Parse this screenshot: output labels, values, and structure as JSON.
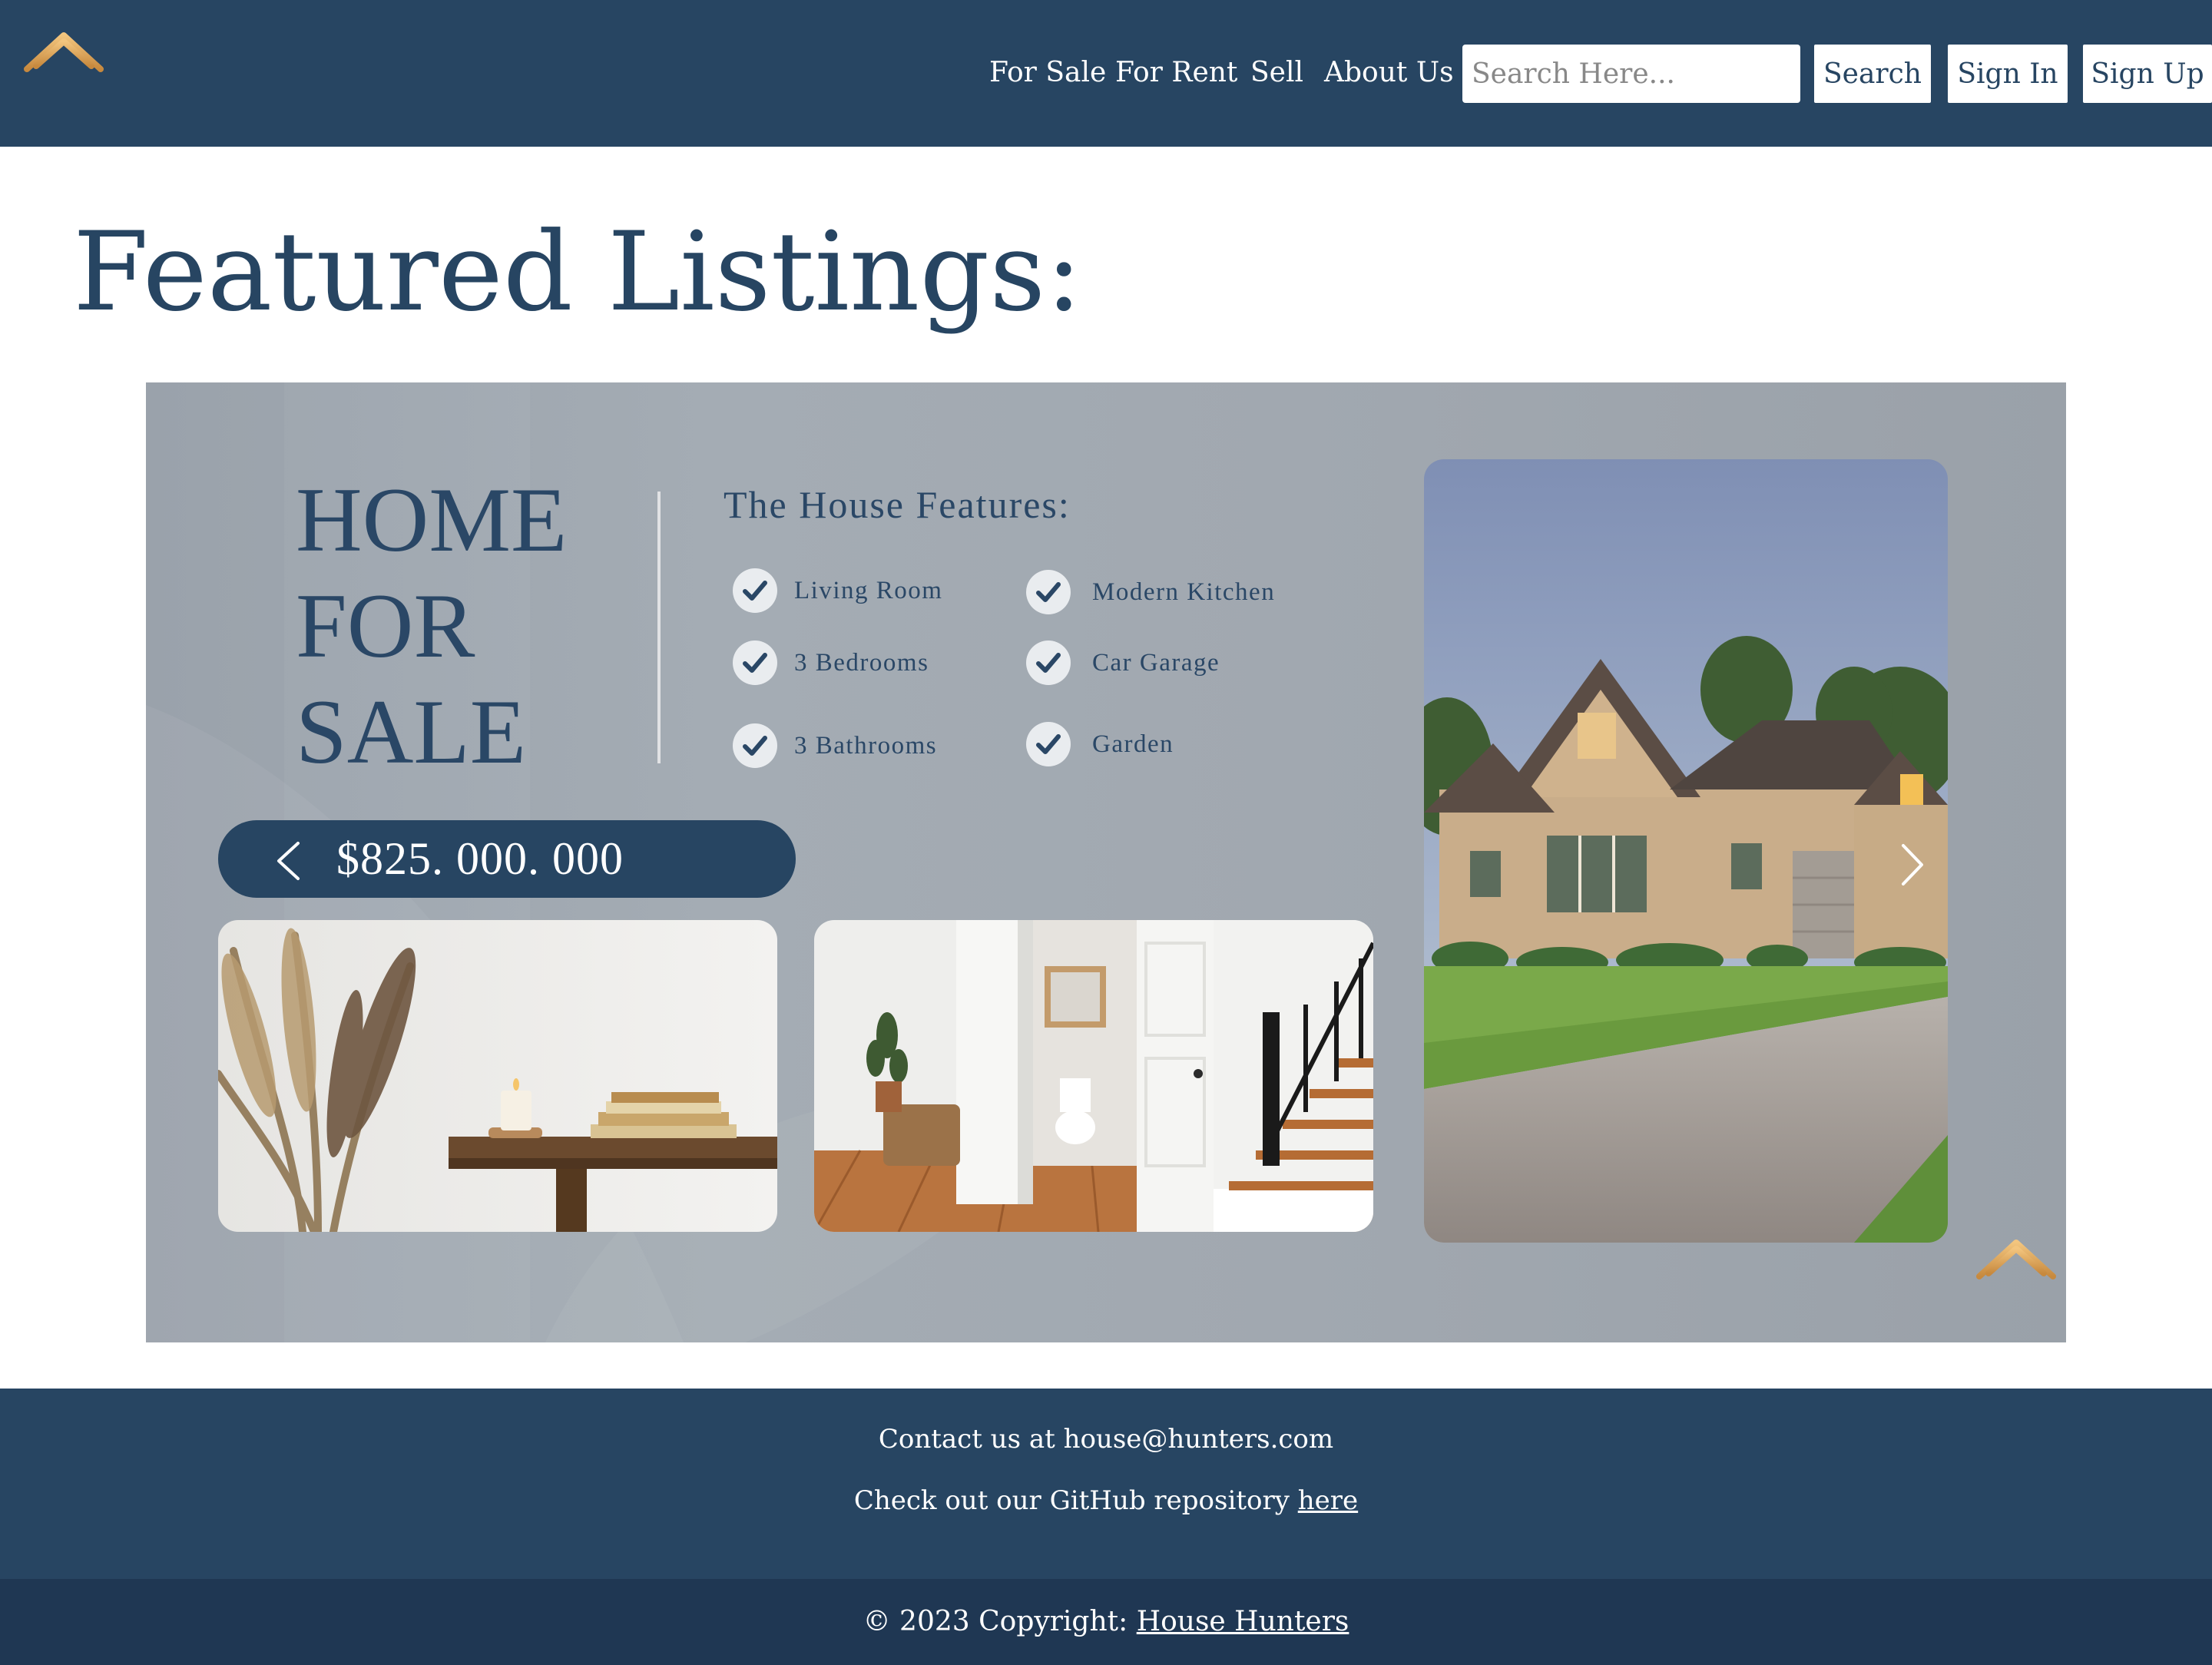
{
  "nav": {
    "logo_icon": "house-hunters-logo-icon",
    "links": [
      "For Sale",
      "For Rent",
      "Sell",
      "About Us"
    ],
    "search_placeholder": "Search Here...",
    "search_button": "Search",
    "signin_button": "Sign In",
    "signup_button": "Sign Up"
  },
  "main": {
    "title": "Featured Listings:",
    "listing": {
      "headline": [
        "HOME",
        "FOR",
        "SALE"
      ],
      "features_title": "The House Features:",
      "features": [
        "Living Room",
        "Modern Kitchen",
        "3 Bedrooms",
        "Car Garage",
        "3 Bathrooms",
        "Garden"
      ],
      "price": "$825. 000. 000",
      "prev_icon": "chevron-left-icon",
      "next_icon": "chevron-right-icon"
    }
  },
  "footer": {
    "contact": "Contact us at house@hunters.com",
    "repo_text": "Check out our GitHub repository",
    "repo_link": "here",
    "copyright_text": "© 2023 Copyright:",
    "copyright_link": "House Hunters"
  },
  "colors": {
    "navy": "#274562",
    "footer_dark": "#1f3753",
    "gold": "#e0a85a"
  }
}
